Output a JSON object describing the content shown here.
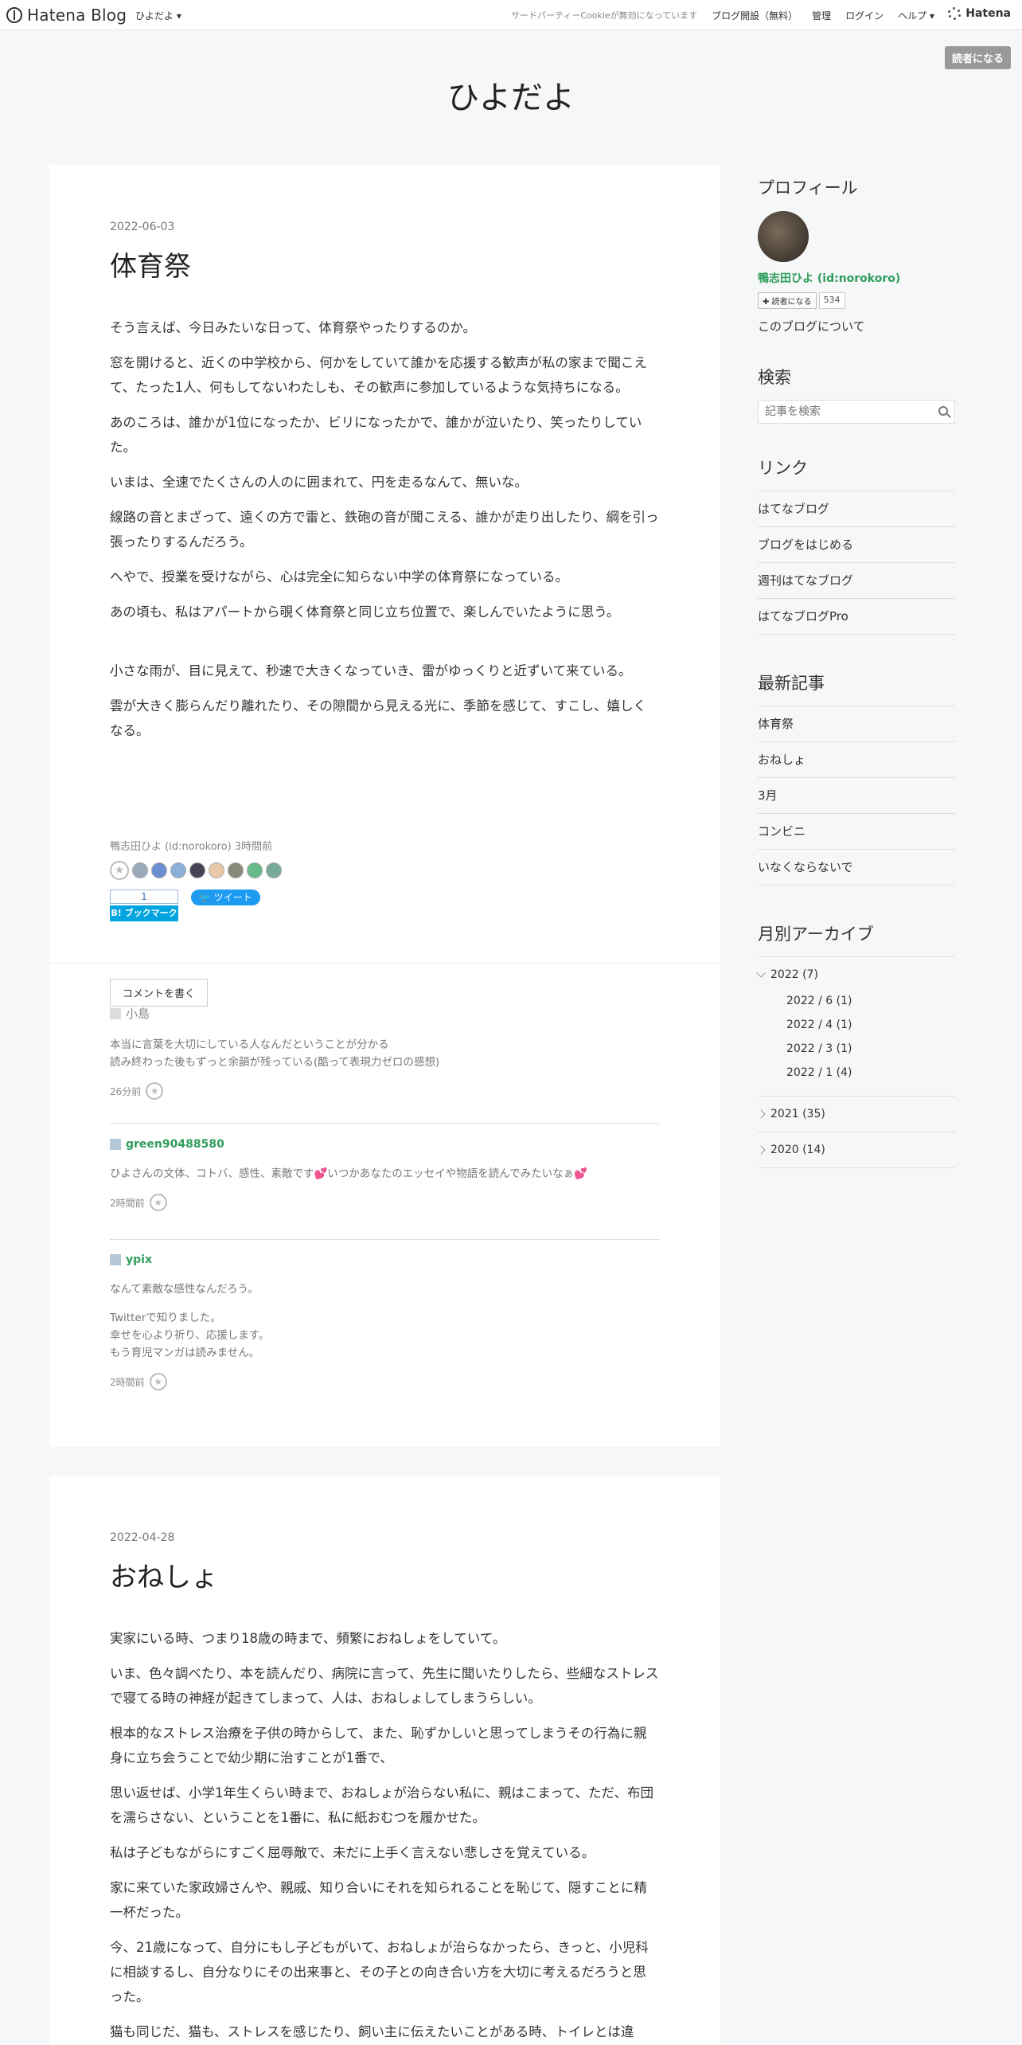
{
  "topbar": {
    "logo": "Hatena Blog",
    "user_menu": "ひよだよ ▾",
    "cookie_notice": "サードパーティーCookieが無効になっています",
    "links": [
      "ブログ開設（無料）",
      "管理",
      "ログイン",
      "ヘルプ ▾"
    ],
    "hatena": "Hatena"
  },
  "subscribe_button": "読者になる",
  "blog_title": "ひよだよ",
  "entry1": {
    "date": "2022-06-03",
    "title": "体育祭",
    "paragraphs": [
      "そう言えば、今日みたいな日って、体育祭やったりするのか。",
      "窓を開けると、近くの中学校から、何かをしていて誰かを応援する歓声が私の家まで聞こえて、たった1人、何もしてないわたしも、その歓声に参加しているような気持ちになる。",
      "あのころは、誰かが1位になったか、ビリになったかで、誰かが泣いたり、笑ったりしていた。",
      "いまは、全速でたくさんの人のに囲まれて、円を走るなんて、無いな。",
      "線路の音とまざって、遠くの方で雷と、鉄砲の音が聞こえる、誰かが走り出したり、綱を引っ張ったりするんだろう。",
      "へやで、授業を受けながら、心は完全に知らない中学の体育祭になっている。",
      "あの頃も、私はアパートから覗く体育祭と同じ立ち位置で、楽しんでいたように思う。",
      "小さな雨が、目に見えて、秒速で大きくなっていき、雷がゆっくりと近ずいて来ている。",
      "雲が大きく膨らんだり離れたり、その隙間から見える光に、季節を感じて、すこし、嬉しくなる。"
    ],
    "meta": "鴨志田ひよ (id:norokoro) 3時間前",
    "bookmark_count": "1",
    "bookmark_label": "B! ブックマーク",
    "tweet_label": "ツイート",
    "comment_button": "コメントを書く",
    "comments": [
      {
        "author": "小島",
        "lines": [
          "本当に言葉を大切にしている人なんだということが分かる",
          "読み終わった後もずっと余韻が残っている(酷って表現力ゼロの感想)"
        ],
        "time": "26分前"
      },
      {
        "author": "green90488580",
        "lines": [
          "ひよさんの文体、コトバ、感性、素敵です💕いつかあなたのエッセイや物語を読んでみたいなぁ💕"
        ],
        "time": "2時間前"
      },
      {
        "author": "ypix",
        "lines": [
          "なんて素敵な感性なんだろう。",
          "",
          "Twitterで知りました。",
          "幸せを心より祈り、応援します。",
          "もう育児マンガは読みません。"
        ],
        "time": "2時間前"
      }
    ]
  },
  "entry2": {
    "date": "2022-04-28",
    "title": "おねしょ",
    "paragraphs": [
      "実家にいる時、つまり18歳の時まで、頻繁におねしょをしていて。",
      "いま、色々調べたり、本を読んだり、病院に言って、先生に聞いたりしたら、些細なストレスで寝てる時の神経が起きてしまって、人は、おねしょしてしまうらしい。",
      "根本的なストレス治療を子供の時からして、また、恥ずかしいと思ってしまうその行為に親身に立ち会うことで幼少期に治すことが1番で、",
      "思い返せば、小学1年生くらい時まで、おねしょが治らない私に、親はこまって、ただ、布団を濡らさない、ということを1番に、私に紙おむつを履かせた。",
      "私は子どもながらにすごく屈辱敵で、未だに上手く言えない悲しさを覚えている。",
      "家に来ていた家政婦さんや、親戚、知り合いにそれを知られることを恥じて、隠すことに精一杯だった。",
      "今、21歳になって、自分にもし子どもがいて、おねしょが治らなかったら、きっと、小児科に相談するし、自分なりにその出来事と、その子との向き合い方を大切に考えるだろうと思った。",
      "猫も同じだ、猫も、ストレスを感じたり、飼い主に伝えたいことがある時、トイレとは違"
    ]
  },
  "sidebar": {
    "profile_heading": "プロフィール",
    "profile_name": "鴨志田ひよ (id:norokoro)",
    "subscribe_small": "✚ 読者になる",
    "subscriber_count": "534",
    "about": "このブログについて",
    "search_heading": "検索",
    "search_placeholder": "記事を検索",
    "links_heading": "リンク",
    "links": [
      "はてなブログ",
      "ブログをはじめる",
      "週刊はてなブログ",
      "はてなブログPro"
    ],
    "recent_heading": "最新記事",
    "recent": [
      "体育祭",
      "おねしょ",
      "3月",
      "コンビニ",
      "いなくならないで"
    ],
    "archive_heading": "月別アーカイブ",
    "archive": [
      {
        "year": "2022 (7)",
        "months": [
          "2022 / 6 (1)",
          "2022 / 4 (1)",
          "2022 / 3 (1)",
          "2022 / 1 (4)"
        ]
      },
      {
        "year": "2021 (35)",
        "months": []
      },
      {
        "year": "2020 (14)",
        "months": []
      }
    ]
  }
}
